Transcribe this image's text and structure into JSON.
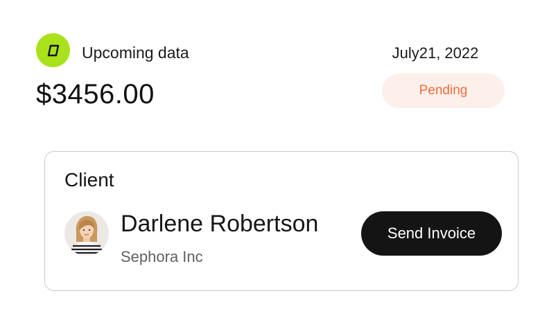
{
  "header": {
    "logo_icon": "parallelogram-logo-icon",
    "logo_color": "#a9e21c",
    "label": "Upcoming data",
    "amount": "$3456.00"
  },
  "summary": {
    "date": "July21, 2022",
    "status": "Pending",
    "status_color": "#ef6b3b",
    "status_background": "#fdf0ea"
  },
  "client": {
    "heading": "Client",
    "avatar_icon": "user-avatar",
    "name": "Darlene Robertson",
    "company": "Sephora Inc",
    "send_invoice_label": "Send Invoice"
  }
}
